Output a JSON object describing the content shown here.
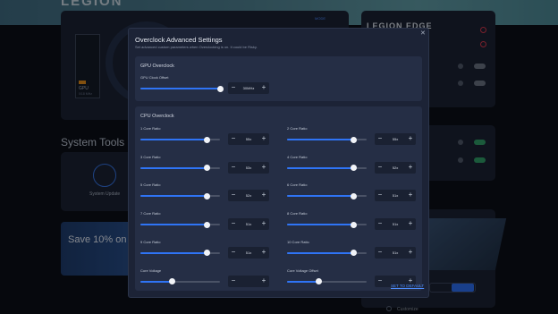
{
  "background": {
    "brand": "LEGION",
    "mode_button": "MODE",
    "gpu_label": "GPU",
    "gpu_sub": "0/18 MHz",
    "edge_title": "LEGION EDGE",
    "system_tools_title": "System Tools",
    "system_update_label": "System Update",
    "promo_text": "Save 10% on Le",
    "customize_label": "Customize"
  },
  "modal": {
    "title": "Overclock Advanced Settings",
    "subtitle": "Set advanced custom parameters when Overclocking is on. It could be Risky.",
    "close_icon": "close-icon",
    "gpu_section": {
      "title": "GPU Overclock",
      "items": [
        {
          "label": "GPU Clock Offset",
          "value": "30MHz",
          "level": 1.0
        }
      ]
    },
    "cpu_section": {
      "title": "CPU Overclock",
      "items": [
        {
          "label": "1 Core Ratio",
          "value": "55x",
          "level": 0.84
        },
        {
          "label": "2 Core Ratio",
          "value": "55x",
          "level": 0.84
        },
        {
          "label": "3 Core Ratio",
          "value": "53x",
          "level": 0.84
        },
        {
          "label": "4 Core Ratio",
          "value": "52x",
          "level": 0.84
        },
        {
          "label": "5 Core Ratio",
          "value": "52x",
          "level": 0.84
        },
        {
          "label": "6 Core Ratio",
          "value": "51x",
          "level": 0.84
        },
        {
          "label": "7 Core Ratio",
          "value": "51x",
          "level": 0.84
        },
        {
          "label": "8 Core Ratio",
          "value": "51x",
          "level": 0.84
        },
        {
          "label": "9 Core Ratio",
          "value": "51x",
          "level": 0.84
        },
        {
          "label": "10 Core Ratio",
          "value": "51x",
          "level": 0.84
        },
        {
          "label": "Core Voltage",
          "value": "",
          "level": 0.4
        },
        {
          "label": "Core Voltage Offset",
          "value": "",
          "level": 0.4
        }
      ]
    },
    "reset_label": "SET TO DEFAULT",
    "stepper_minus": "−",
    "stepper_plus": "+"
  },
  "colors": {
    "accent": "#2f74f5",
    "link": "#4d8dff",
    "panel": "#1c2336",
    "section": "#252e45"
  }
}
